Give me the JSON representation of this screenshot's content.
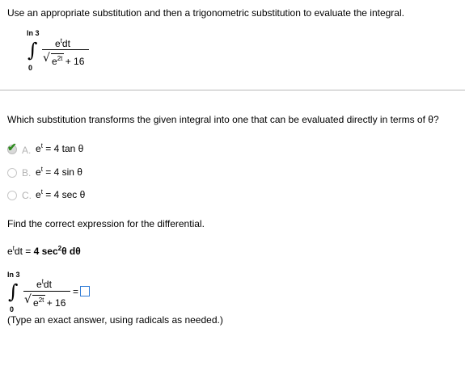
{
  "instruction": "Use an appropriate substitution and then a trigonometric substitution to evaluate the integral.",
  "integral_top": {
    "upper_limit": "ln 3",
    "lower_limit": "0",
    "numerator_base": "e",
    "numerator_exp": "t",
    "numerator_suffix": "dt",
    "den_radicand_base": "e",
    "den_radicand_exp": "2t",
    "den_plus": "+ 16"
  },
  "question": "Which substitution transforms the given integral into one that can be evaluated directly in terms of θ?",
  "options": [
    {
      "letter": "A.",
      "base": "e",
      "exp": "t",
      "rest": "= 4 tan θ",
      "selected": true
    },
    {
      "letter": "B.",
      "base": "e",
      "exp": "t",
      "rest": "= 4 sin θ",
      "selected": false
    },
    {
      "letter": "C.",
      "base": "e",
      "exp": "t",
      "rest": "= 4 sec θ",
      "selected": false
    }
  ],
  "differential_prompt": "Find the correct expression for the differential.",
  "differential": {
    "lhs_base": "e",
    "lhs_exp": "t",
    "lhs_suffix": "dt =",
    "answer_pre": "4 sec",
    "answer_exp": "2",
    "answer_post": "θ dθ"
  },
  "integral_bottom": {
    "upper_limit": "ln 3",
    "lower_limit": "0",
    "numerator_base": "e",
    "numerator_exp": "t",
    "numerator_suffix": "dt",
    "den_radicand_base": "e",
    "den_radicand_exp": "2t",
    "den_plus": "+ 16",
    "equals": "="
  },
  "hint": "(Type an exact answer, using radicals as needed.)",
  "colors": {
    "check": "#2e8b1f",
    "answer_box_border": "#2f7bd6",
    "separator": "#b8b8b8"
  }
}
